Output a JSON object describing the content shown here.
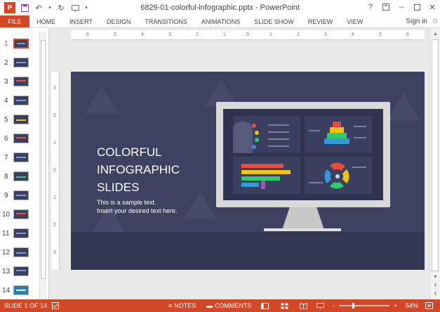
{
  "window": {
    "title": "6829-01-colorful-infographic.pptx - PowerPoint",
    "app_logo": "P",
    "help": "?",
    "controls": [
      "restore-icon",
      "minimize-icon",
      "maximize-icon",
      "close-icon"
    ]
  },
  "ribbon": {
    "tabs": [
      "FILE",
      "HOME",
      "INSERT",
      "DESIGN",
      "TRANSITIONS",
      "ANIMATIONS",
      "SLIDE SHOW",
      "REVIEW",
      "VIEW"
    ],
    "signin": "Sign in"
  },
  "thumbnails": {
    "numbers": [
      "1",
      "2",
      "3",
      "4",
      "5",
      "6",
      "7",
      "8",
      "9",
      "10",
      "11",
      "12",
      "13",
      "14"
    ],
    "active": "1"
  },
  "rulers": {
    "horizontal": [
      "6",
      "5",
      "4",
      "3",
      "2",
      "1",
      "0",
      "1",
      "2",
      "3",
      "4",
      "5",
      "6"
    ],
    "vertical": [
      "3",
      "2",
      "1",
      "0",
      "1",
      "2",
      "3"
    ]
  },
  "slide": {
    "title_lines": [
      "COLORFUL",
      "INFOGRAPHIC",
      "SLIDES"
    ],
    "subtitle_lines": [
      "This is a sample text.",
      "Insert your desired text here."
    ],
    "accent_colors": [
      "#e84c3d",
      "#f1c40f",
      "#2ecc71",
      "#3498db",
      "#9b59b6"
    ]
  },
  "statusbar": {
    "slide_info": "SLIDE 1 OF 14",
    "notes": "NOTES",
    "comments": "COMMENTS",
    "zoom_minus": "-",
    "zoom_plus": "+",
    "zoom": "54%",
    "zoom_level_fraction": 0.54
  }
}
